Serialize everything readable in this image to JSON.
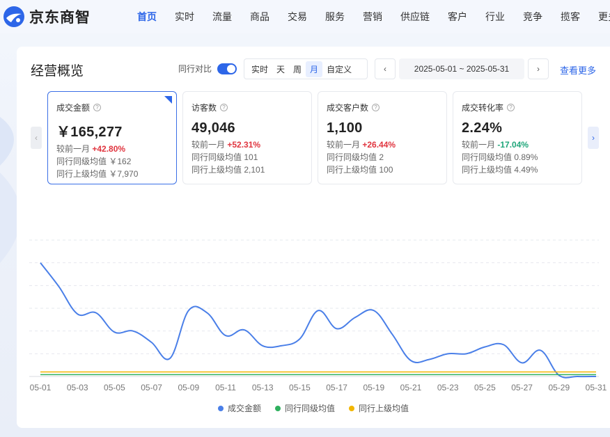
{
  "app": {
    "logo_text": "京东商智",
    "nav": [
      "首页",
      "实时",
      "流量",
      "商品",
      "交易",
      "服务",
      "营销",
      "供应链",
      "客户",
      "行业",
      "竞争",
      "揽客",
      "更多"
    ],
    "active_nav": 0
  },
  "section": {
    "title": "经营概览",
    "compare_label": "同行对比",
    "compare_on": true,
    "periods": [
      "实时",
      "天",
      "周",
      "月",
      "自定义"
    ],
    "active_period": 3,
    "date_range": "2025-05-01 ~ 2025-05-31",
    "more_label": "查看更多",
    "prev_glyph": "‹",
    "next_glyph": "›",
    "help_glyph": "?"
  },
  "metrics": [
    {
      "name": "成交金额",
      "value": "￥165,277",
      "compare_label": "较前一月",
      "change": "+42.80%",
      "trend": "up",
      "peer_label": "同行同级均值",
      "peer_value": "￥162",
      "top_label": "同行上级均值",
      "top_value": "￥7,970"
    },
    {
      "name": "访客数",
      "value": "49,046",
      "compare_label": "较前一月",
      "change": "+52.31%",
      "trend": "up",
      "peer_label": "同行同级均值",
      "peer_value": "101",
      "top_label": "同行上级均值",
      "top_value": "2,101"
    },
    {
      "name": "成交客户数",
      "value": "1,100",
      "compare_label": "较前一月",
      "change": "+26.44%",
      "trend": "up",
      "peer_label": "同行同级均值",
      "peer_value": "2",
      "top_label": "同行上级均值",
      "top_value": "100"
    },
    {
      "name": "成交转化率",
      "value": "2.24%",
      "compare_label": "较前一月",
      "change": "-17.04%",
      "trend": "down",
      "peer_label": "同行同级均值",
      "peer_value": "0.89%",
      "top_label": "同行上级均值",
      "top_value": "4.49%"
    }
  ],
  "chart_data": {
    "type": "line",
    "x": [
      "05-01",
      "05-02",
      "05-03",
      "05-04",
      "05-05",
      "05-06",
      "05-07",
      "05-08",
      "05-09",
      "05-10",
      "05-11",
      "05-12",
      "05-13",
      "05-14",
      "05-15",
      "05-16",
      "05-17",
      "05-18",
      "05-19",
      "05-20",
      "05-21",
      "05-22",
      "05-23",
      "05-24",
      "05-25",
      "05-26",
      "05-27",
      "05-28",
      "05-29",
      "05-30",
      "05-31"
    ],
    "x_tick_labels": [
      "05-01",
      "05-03",
      "05-05",
      "05-07",
      "05-09",
      "05-11",
      "05-13",
      "05-15",
      "05-17",
      "05-19",
      "05-21",
      "05-23",
      "05-25",
      "05-27",
      "05-29",
      "05-31"
    ],
    "series": [
      {
        "name": "成交金额",
        "color": "#4a7fe8",
        "values": [
          10000,
          7900,
          5500,
          5600,
          3900,
          4000,
          3000,
          1600,
          5800,
          5600,
          3600,
          4100,
          2700,
          2700,
          3300,
          5800,
          4200,
          5200,
          5800,
          3700,
          1400,
          1500,
          2000,
          2000,
          2600,
          2800,
          1200,
          2300,
          100,
          0,
          0
        ]
      },
      {
        "name": "同行同级均值",
        "color": "#2fb05e",
        "values": [
          160,
          160,
          160,
          160,
          160,
          160,
          160,
          160,
          160,
          160,
          160,
          160,
          160,
          160,
          160,
          160,
          160,
          160,
          160,
          160,
          160,
          160,
          160,
          160,
          160,
          160,
          160,
          160,
          160,
          160,
          160
        ]
      },
      {
        "name": "同行上级均值",
        "color": "#f2b600",
        "values": [
          400,
          400,
          400,
          400,
          400,
          400,
          400,
          400,
          400,
          400,
          400,
          400,
          400,
          400,
          400,
          400,
          400,
          400,
          400,
          400,
          400,
          400,
          400,
          400,
          400,
          400,
          400,
          400,
          400,
          400,
          400
        ]
      }
    ],
    "ylim": [
      0,
      12000
    ],
    "grid": true,
    "y_tick_labels_visible": false,
    "legend_position": "bottom-center"
  }
}
